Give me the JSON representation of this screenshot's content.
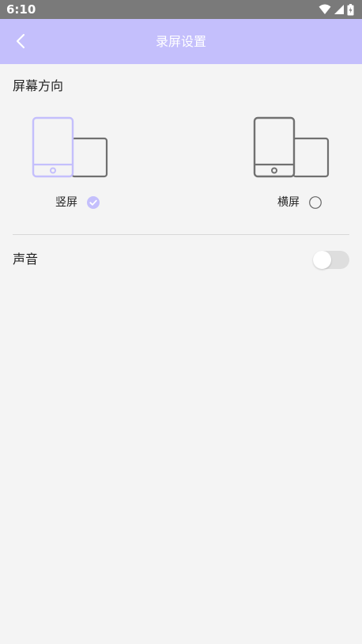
{
  "status_bar": {
    "time": "6:10",
    "icons": [
      "wifi-icon",
      "signal-icon",
      "battery-icon"
    ]
  },
  "app_bar": {
    "title": "录屏设置",
    "back_icon": "back-arrow-icon",
    "background_color": "#c4bffc"
  },
  "orientation": {
    "section_title": "屏幕方向",
    "options": [
      {
        "label": "竖屏",
        "selected": true,
        "icon": "portrait-device-icon"
      },
      {
        "label": "横屏",
        "selected": false,
        "icon": "landscape-device-icon"
      }
    ],
    "accent_color": "#c4bffc"
  },
  "sound": {
    "label": "声音",
    "enabled": false
  }
}
